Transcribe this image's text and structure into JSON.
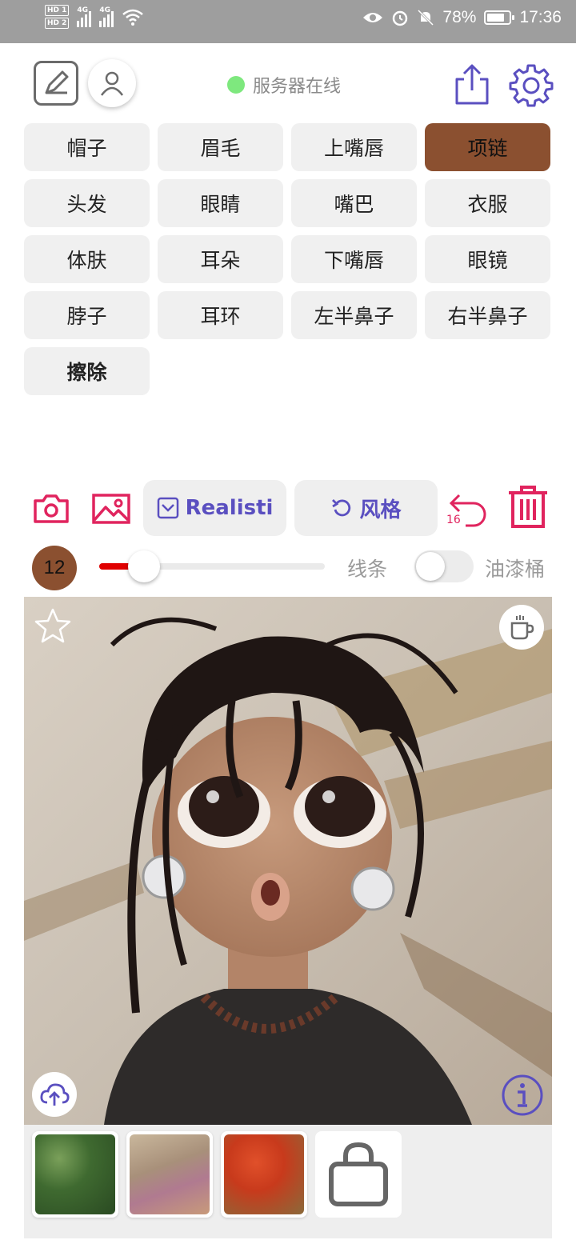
{
  "status_bar": {
    "hd1": "HD 1",
    "hd2": "HD 2",
    "net1": "4G",
    "net2": "4G",
    "battery_percent": "78%",
    "battery_level": 0.78,
    "time": "17:36"
  },
  "header": {
    "server_status": "服务器在线",
    "status_color": "#7ee87e"
  },
  "categories": [
    {
      "label": "帽子",
      "active": false
    },
    {
      "label": "眉毛",
      "active": false
    },
    {
      "label": "上嘴唇",
      "active": false
    },
    {
      "label": "项链",
      "active": true
    },
    {
      "label": "头发",
      "active": false
    },
    {
      "label": "眼睛",
      "active": false
    },
    {
      "label": "嘴巴",
      "active": false
    },
    {
      "label": "衣服",
      "active": false
    },
    {
      "label": "体肤",
      "active": false
    },
    {
      "label": "耳朵",
      "active": false
    },
    {
      "label": "下嘴唇",
      "active": false
    },
    {
      "label": "眼镜",
      "active": false
    },
    {
      "label": "脖子",
      "active": false
    },
    {
      "label": "耳环",
      "active": false
    },
    {
      "label": "左半鼻子",
      "active": false
    },
    {
      "label": "右半鼻子",
      "active": false
    },
    {
      "label": "擦除",
      "active": false
    }
  ],
  "tools": {
    "style_select_label": "Realisti",
    "style_button_label": "风格",
    "undo_count": "16"
  },
  "brush": {
    "size": "12",
    "slider_value": 0.2,
    "line_label": "线条",
    "bucket_label": "油漆桶",
    "bucket_enabled": false
  },
  "colors": {
    "accent": "#5a4fc0",
    "danger": "#e0245e",
    "active_category": "#8b5030",
    "slider_fill": "#e00000"
  },
  "icons": {
    "draw": "draw-mode-icon",
    "user": "user-icon",
    "share": "share-icon",
    "settings": "gear-icon",
    "camera": "camera-icon",
    "gallery": "image-icon",
    "undo": "undo-icon",
    "delete": "trash-icon",
    "star": "star-icon",
    "cup": "coffee-cup-icon",
    "upload": "cloud-upload-icon",
    "info": "info-icon",
    "shop": "shopping-bag-icon"
  }
}
